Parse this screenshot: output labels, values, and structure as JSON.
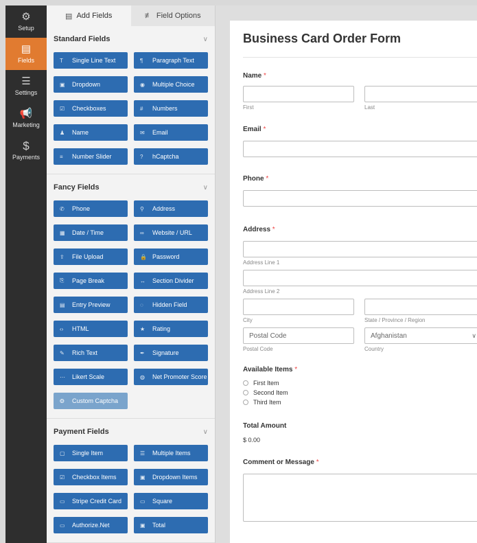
{
  "nav": [
    {
      "label": "Setup",
      "icon": "gear-icon",
      "glyph": "⚙"
    },
    {
      "label": "Fields",
      "icon": "fields-icon",
      "glyph": "▤",
      "active": true
    },
    {
      "label": "Settings",
      "icon": "sliders-icon",
      "glyph": "☰"
    },
    {
      "label": "Marketing",
      "icon": "megaphone-icon",
      "glyph": "📢"
    },
    {
      "label": "Payments",
      "icon": "dollar-icon",
      "glyph": "$"
    }
  ],
  "tabs": {
    "add_fields": "Add Fields",
    "field_options": "Field Options"
  },
  "sections": {
    "standard": {
      "title": "Standard Fields",
      "items": [
        {
          "label": "Single Line Text",
          "glyph": "T"
        },
        {
          "label": "Paragraph Text",
          "glyph": "¶"
        },
        {
          "label": "Dropdown",
          "glyph": "▣"
        },
        {
          "label": "Multiple Choice",
          "glyph": "◉"
        },
        {
          "label": "Checkboxes",
          "glyph": "☑"
        },
        {
          "label": "Numbers",
          "glyph": "#"
        },
        {
          "label": "Name",
          "glyph": "♟"
        },
        {
          "label": "Email",
          "glyph": "✉"
        },
        {
          "label": "Number Slider",
          "glyph": "≡"
        },
        {
          "label": "hCaptcha",
          "glyph": "?"
        }
      ]
    },
    "fancy": {
      "title": "Fancy Fields",
      "items": [
        {
          "label": "Phone",
          "glyph": "✆"
        },
        {
          "label": "Address",
          "glyph": "⚲"
        },
        {
          "label": "Date / Time",
          "glyph": "▦"
        },
        {
          "label": "Website / URL",
          "glyph": "∞"
        },
        {
          "label": "File Upload",
          "glyph": "⇪"
        },
        {
          "label": "Password",
          "glyph": "🔒"
        },
        {
          "label": "Page Break",
          "glyph": "⎘"
        },
        {
          "label": "Section Divider",
          "glyph": "↔"
        },
        {
          "label": "Entry Preview",
          "glyph": "▤"
        },
        {
          "label": "Hidden Field",
          "glyph": "◌"
        },
        {
          "label": "HTML",
          "glyph": "‹›"
        },
        {
          "label": "Rating",
          "glyph": "★"
        },
        {
          "label": "Rich Text",
          "glyph": "✎"
        },
        {
          "label": "Signature",
          "glyph": "✒"
        },
        {
          "label": "Likert Scale",
          "glyph": "⋯"
        },
        {
          "label": "Net Promoter Score",
          "glyph": "◍"
        },
        {
          "label": "Custom Captcha",
          "glyph": "❂",
          "disabled": true
        }
      ]
    },
    "payment": {
      "title": "Payment Fields",
      "items": [
        {
          "label": "Single Item",
          "glyph": "▢"
        },
        {
          "label": "Multiple Items",
          "glyph": "☰"
        },
        {
          "label": "Checkbox Items",
          "glyph": "☑"
        },
        {
          "label": "Dropdown Items",
          "glyph": "▣"
        },
        {
          "label": "Stripe Credit Card",
          "glyph": "▭"
        },
        {
          "label": "Square",
          "glyph": "▭"
        },
        {
          "label": "Authorize.Net",
          "glyph": "▭"
        },
        {
          "label": "Total",
          "glyph": "▣"
        }
      ]
    }
  },
  "form": {
    "title": "Business Card Order Form",
    "required_mark": "*",
    "name": {
      "label": "Name",
      "first": "First",
      "last": "Last"
    },
    "email": {
      "label": "Email"
    },
    "phone": {
      "label": "Phone"
    },
    "address": {
      "label": "Address",
      "line1": "Address Line 1",
      "line2": "Address Line 2",
      "city": "City",
      "state": "State / Province / Region",
      "postal_placeholder": "Postal Code",
      "postal": "Postal Code",
      "country_value": "Afghanistan",
      "country": "Country"
    },
    "items": {
      "label": "Available Items",
      "options": [
        "First Item",
        "Second Item",
        "Third Item"
      ]
    },
    "total": {
      "label": "Total Amount",
      "value": "$ 0.00"
    },
    "comment": {
      "label": "Comment or Message"
    }
  },
  "colors": {
    "accent": "#e17b30",
    "button": "#2d6cb1",
    "required": "#ee4444"
  }
}
